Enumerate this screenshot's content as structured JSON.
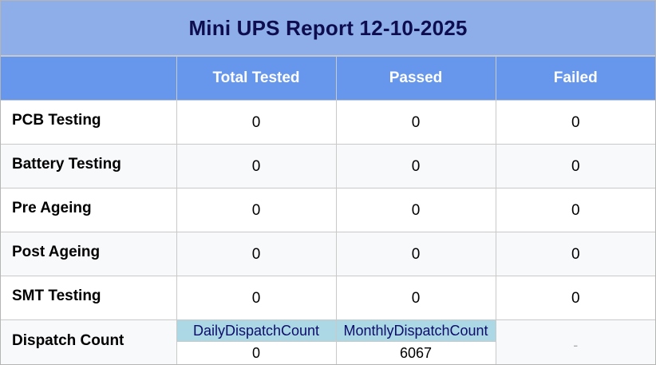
{
  "report": {
    "title": "Mini UPS Report 12-10-2025",
    "columns": [
      "",
      "Total Tested",
      "Passed",
      "Failed"
    ],
    "rows": [
      {
        "label": "PCB Testing",
        "total": "0",
        "passed": "0",
        "failed": "0"
      },
      {
        "label": "Battery Testing",
        "total": "0",
        "passed": "0",
        "failed": "0"
      },
      {
        "label": "Pre Ageing",
        "total": "0",
        "passed": "0",
        "failed": "0"
      },
      {
        "label": "Post Ageing",
        "total": "0",
        "passed": "0",
        "failed": "0"
      },
      {
        "label": "SMT Testing",
        "total": "0",
        "passed": "0",
        "failed": "0"
      }
    ],
    "dispatch": {
      "label": "Dispatch Count",
      "daily_label": "DailyDispatchCount",
      "daily_value": "0",
      "monthly_label": "MonthlyDispatchCount",
      "monthly_value": "6067",
      "failed_placeholder": "-"
    }
  },
  "colors": {
    "title_bg": "#8eaee9",
    "title_text": "#0d0d4f",
    "header_bg": "#6797ec",
    "header_text": "#ffffff",
    "dispatch_head_bg": "#acd8e6",
    "dispatch_head_text": "#0d0d6a",
    "grid_line": "#c9c9c9"
  }
}
